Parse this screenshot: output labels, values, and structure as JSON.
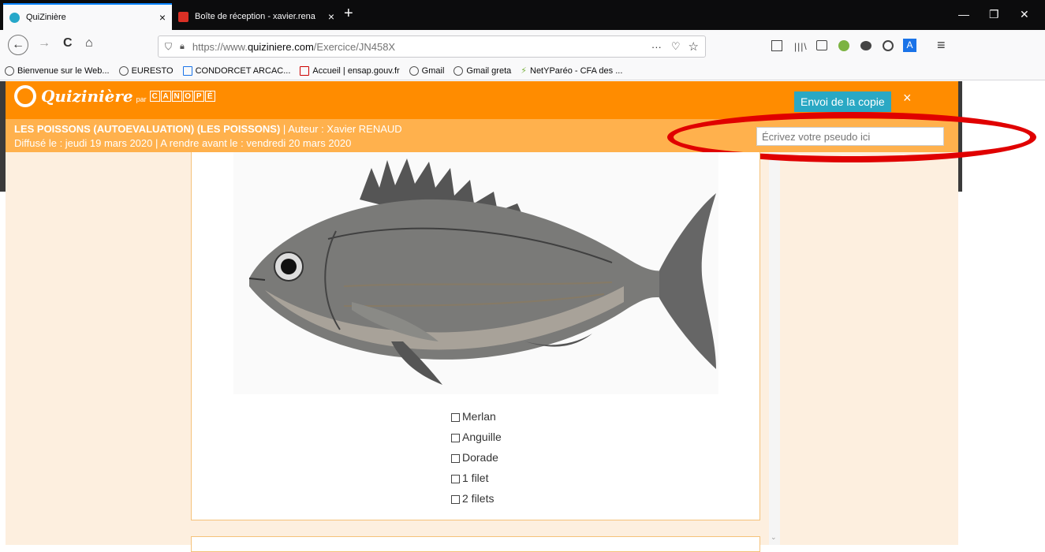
{
  "browser": {
    "tabs": [
      {
        "title": "QuiZinière",
        "close": "×",
        "active": true
      },
      {
        "title": "Boîte de réception - xavier.rena",
        "close": "×",
        "active": false
      }
    ],
    "new_tab": "+",
    "window_controls": {
      "minimize": "—",
      "restore": "❐",
      "close": "✕"
    },
    "nav": {
      "back": "←",
      "forward": "→",
      "reload": "C",
      "home": "⌂"
    },
    "url": {
      "scheme": "https://www.",
      "host": "quiziniere.com",
      "path": "/Exercice/JN458X"
    },
    "url_actions": {
      "more": "···",
      "pocket": "♡",
      "star": "☆"
    },
    "bookmarks": [
      "Bienvenue sur le Web...",
      "EURESTO",
      "CONDORCET ARCAC...",
      "Accueil | ensap.gouv.fr",
      "Gmail",
      "Gmail greta",
      "NetYParéo - CFA des ..."
    ],
    "menu": "≡"
  },
  "app": {
    "logo_text": "Quizinière",
    "logo_par": "par",
    "canope_letters": [
      "C",
      "A",
      "N",
      "O",
      "P",
      "É"
    ],
    "send_button": "Envoi de la copie",
    "close": "×",
    "title": "LES POISSONS (AUTOEVALUATION) (LES POISSONS)",
    "author": " | Auteur : Xavier RENAUD",
    "dates": "Diffusé le : jeudi 19 mars 2020  | A rendre avant le : vendredi 20 mars 2020",
    "pseudo_placeholder": "Écrivez votre pseudo ici"
  },
  "question": {
    "options": [
      "Merlan",
      "Anguille",
      "Dorade",
      "1 filet",
      "2 filets"
    ]
  },
  "colors": {
    "header": "#ff8c00",
    "subheader": "#ffb14d",
    "send_button": "#2aa8c4",
    "annotation_ring": "#e00000",
    "page_bg": "#fdefdf"
  }
}
